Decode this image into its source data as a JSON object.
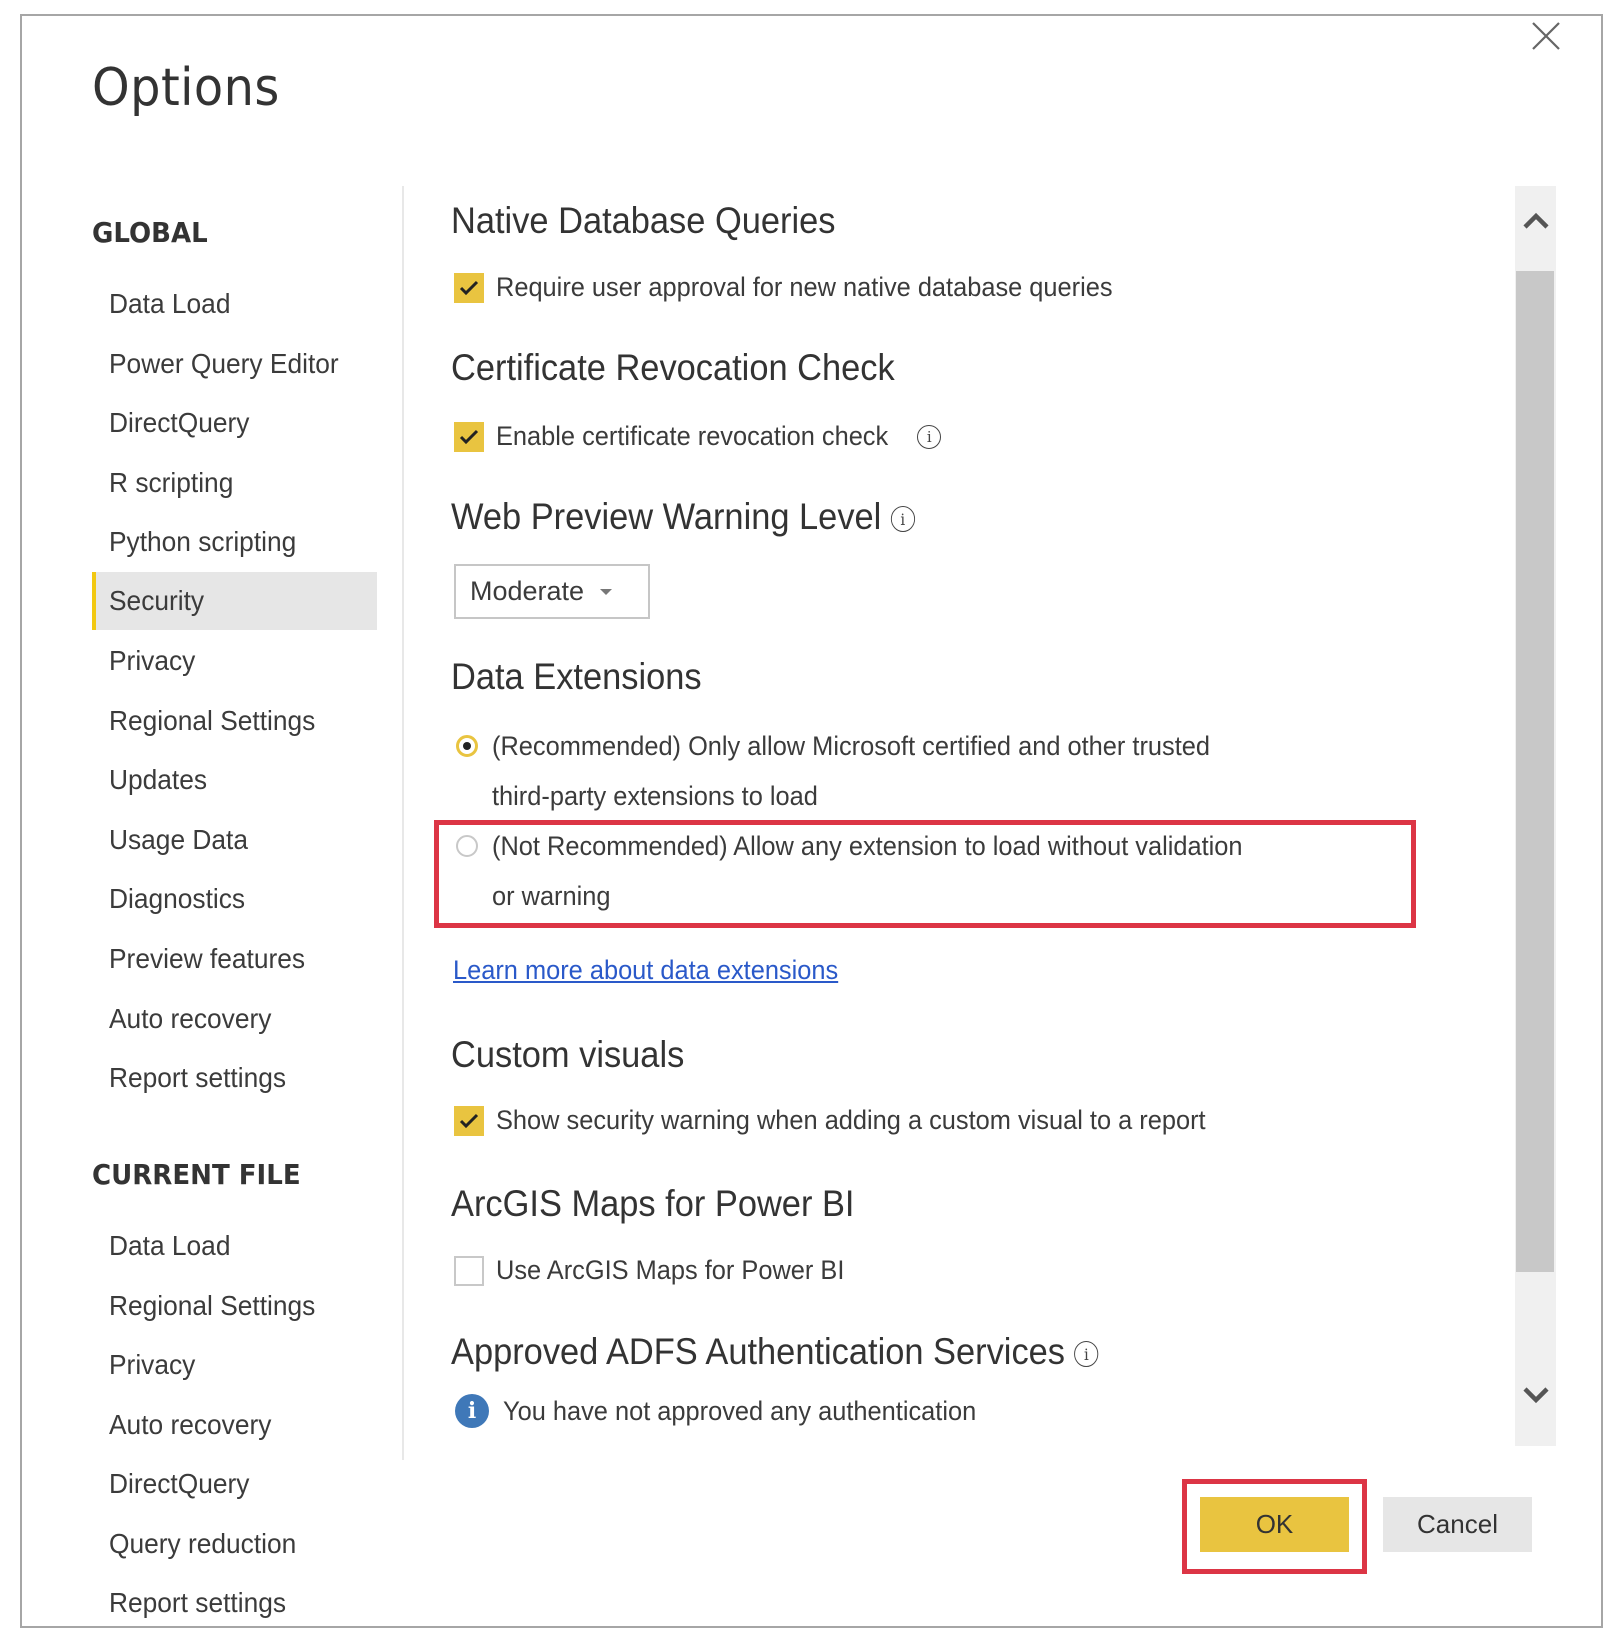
{
  "dialog": {
    "title": "Options",
    "close_icon": "close-icon"
  },
  "sidebar": {
    "global_header": "GLOBAL",
    "global_items": [
      {
        "label": "Data Load",
        "active": false
      },
      {
        "label": "Power Query Editor",
        "active": false
      },
      {
        "label": "DirectQuery",
        "active": false
      },
      {
        "label": "R scripting",
        "active": false
      },
      {
        "label": "Python scripting",
        "active": false
      },
      {
        "label": "Security",
        "active": true
      },
      {
        "label": "Privacy",
        "active": false
      },
      {
        "label": "Regional Settings",
        "active": false
      },
      {
        "label": "Updates",
        "active": false
      },
      {
        "label": "Usage Data",
        "active": false
      },
      {
        "label": "Diagnostics",
        "active": false
      },
      {
        "label": "Preview features",
        "active": false
      },
      {
        "label": "Auto recovery",
        "active": false
      },
      {
        "label": "Report settings",
        "active": false
      }
    ],
    "current_file_header": "CURRENT FILE",
    "current_file_items": [
      {
        "label": "Data Load"
      },
      {
        "label": "Regional Settings"
      },
      {
        "label": "Privacy"
      },
      {
        "label": "Auto recovery"
      },
      {
        "label": "DirectQuery"
      },
      {
        "label": "Query reduction"
      },
      {
        "label": "Report settings"
      }
    ]
  },
  "content": {
    "native_db": {
      "heading": "Native Database Queries",
      "checkbox_label": "Require user approval for new native database queries",
      "checked": true
    },
    "cert_revocation": {
      "heading": "Certificate Revocation Check",
      "checkbox_label": "Enable certificate revocation check",
      "checked": true,
      "info_icon": "info-icon"
    },
    "web_preview": {
      "heading": "Web Preview Warning Level",
      "info_icon": "info-icon",
      "selected": "Moderate"
    },
    "data_extensions": {
      "heading": "Data Extensions",
      "options": [
        {
          "line1": "(Recommended) Only allow Microsoft certified and other trusted",
          "line2": "third-party extensions to load",
          "selected": true
        },
        {
          "line1": "(Not Recommended) Allow any extension to load without validation",
          "line2": "or warning",
          "selected": false
        }
      ],
      "link": "Learn more about data extensions"
    },
    "custom_visuals": {
      "heading": "Custom visuals",
      "checkbox_label": "Show security warning when adding a custom visual to a report",
      "checked": true
    },
    "arcgis": {
      "heading": "ArcGIS Maps for Power BI",
      "checkbox_label": "Use ArcGIS Maps for Power BI",
      "checked": false
    },
    "adfs": {
      "heading": "Approved ADFS Authentication Services",
      "message": "You have not approved any authentication"
    }
  },
  "buttons": {
    "ok": "OK",
    "cancel": "Cancel"
  },
  "colors": {
    "accent_yellow": "#e9c440",
    "selected_indicator": "#f2c811",
    "highlight_red": "#dc3545",
    "link_blue": "#2a59c9",
    "info_blue": "#3f78b8"
  }
}
